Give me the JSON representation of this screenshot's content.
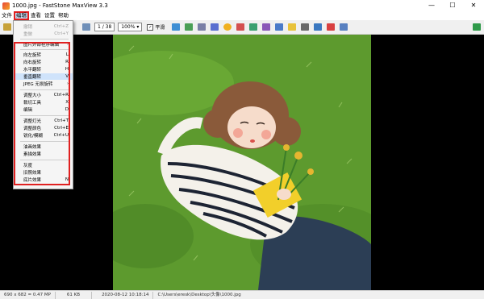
{
  "window": {
    "title": "1000.jpg - FastStone MaxView 3.3",
    "min": "—",
    "max": "☐",
    "close": "✕"
  },
  "menubar": {
    "items": [
      "文件",
      "编辑",
      "查看",
      "设置",
      "帮助"
    ]
  },
  "toolbar": {
    "page": "1 / 38",
    "zoom": "100%",
    "zoom_arrow": "▾",
    "fit_label": "平滑",
    "fit_checked": true
  },
  "dropdown": {
    "items": [
      {
        "label": "撤销",
        "shortcut": "Ctrl+Z",
        "disabled": true
      },
      {
        "label": "重做",
        "shortcut": "Ctrl+Y",
        "disabled": true
      },
      {
        "label": "图片外部程序编辑",
        "shortcut": "›",
        "disabled": false
      },
      {
        "label": "向左旋转",
        "shortcut": "L",
        "disabled": false
      },
      {
        "label": "向右旋转",
        "shortcut": "R",
        "disabled": false
      },
      {
        "label": "水平翻转",
        "shortcut": "H",
        "disabled": false
      },
      {
        "label": "垂直翻转",
        "shortcut": "V",
        "disabled": false
      },
      {
        "label": "JPEG 无损旋转",
        "shortcut": "›",
        "disabled": false
      },
      {
        "label": "调整大小",
        "shortcut": "Ctrl+R",
        "disabled": false
      },
      {
        "label": "裁切工具",
        "shortcut": "X",
        "disabled": false
      },
      {
        "label": "编辑",
        "shortcut": "D",
        "disabled": false
      },
      {
        "label": "调整灯光",
        "shortcut": "Ctrl+T",
        "disabled": false
      },
      {
        "label": "调整颜色",
        "shortcut": "Ctrl+E",
        "disabled": false
      },
      {
        "label": "锐化/模糊",
        "shortcut": "Ctrl+U",
        "disabled": false
      },
      {
        "label": "油画效果",
        "shortcut": "",
        "disabled": false
      },
      {
        "label": "素描效果",
        "shortcut": "",
        "disabled": false
      },
      {
        "label": "灰度",
        "shortcut": "",
        "disabled": false
      },
      {
        "label": "旧照效果",
        "shortcut": "",
        "disabled": false
      },
      {
        "label": "底片效果",
        "shortcut": "N",
        "disabled": false
      }
    ]
  },
  "statusbar": {
    "dimensions": "690 x 682 = 0.47 MP",
    "size": "61 KB",
    "date": "2020-08-12 10:18:14",
    "path": "C:\\Users\\eresk\\Desktop\\头像\\1000.jpg"
  },
  "colors": {
    "menu_highlight": "#cde0f7",
    "annotation_red": "#e02020",
    "grass": "#5d9a2e"
  }
}
